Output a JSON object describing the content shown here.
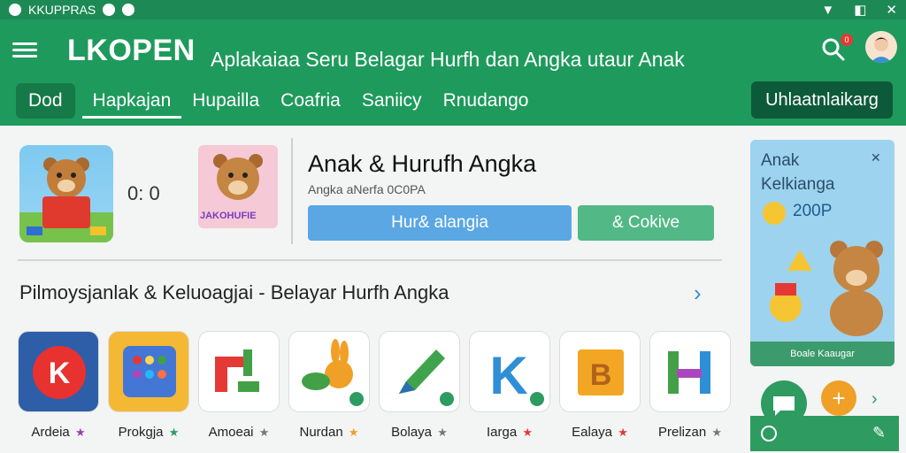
{
  "status": {
    "app_name": "KKUPPRAS"
  },
  "appbar": {
    "title": "LKOPEN",
    "subtitle": "Aplakaiaa Seru Belagar Hurfh dan Angka utaur Anak",
    "notification_count": "0"
  },
  "tabs": [
    {
      "label": "Dod"
    },
    {
      "label": "Hapkajan"
    },
    {
      "label": "Hupailla"
    },
    {
      "label": "Coafria"
    },
    {
      "label": "Saniicy"
    },
    {
      "label": "Rnudango"
    }
  ],
  "top_button": {
    "label": "Uhlaatnlaikarg"
  },
  "featured": {
    "mid_text": "0: 0",
    "thumb_label": "JAKOHUFIE",
    "title": "Anak & Hurufh Angka",
    "subtitle": "Angka aNerfa 0C0PA",
    "primary_button": "Hur& alangia",
    "secondary_button": "& Cokive"
  },
  "section": {
    "title": "Pilmoysjanlak & Keluoagjai - Belayar Hurfh Angka"
  },
  "apps": [
    {
      "label": "Ardeia",
      "star_color": "#9b3db5"
    },
    {
      "label": "Prokgja",
      "star_color": "#2e9b61"
    },
    {
      "label": "Amoeai",
      "star_color": "#777777"
    },
    {
      "label": "Nurdan",
      "star_color": "#f0a027"
    },
    {
      "label": "Bolaya",
      "star_color": "#777777"
    },
    {
      "label": "Iarga",
      "star_color": "#e53935"
    },
    {
      "label": "Ealaya",
      "star_color": "#e53935"
    },
    {
      "label": "Prelizan",
      "star_color": "#777777"
    }
  ],
  "promo": {
    "title_line1": "Anak",
    "title_line2": "Kelkianga",
    "price": "200P",
    "footer": "Boale Kaaugar"
  },
  "colors": {
    "primary": "#1e9a5c",
    "accent": "#5aa7e4",
    "secondary": "#52b886",
    "fab": "#f0a027"
  }
}
